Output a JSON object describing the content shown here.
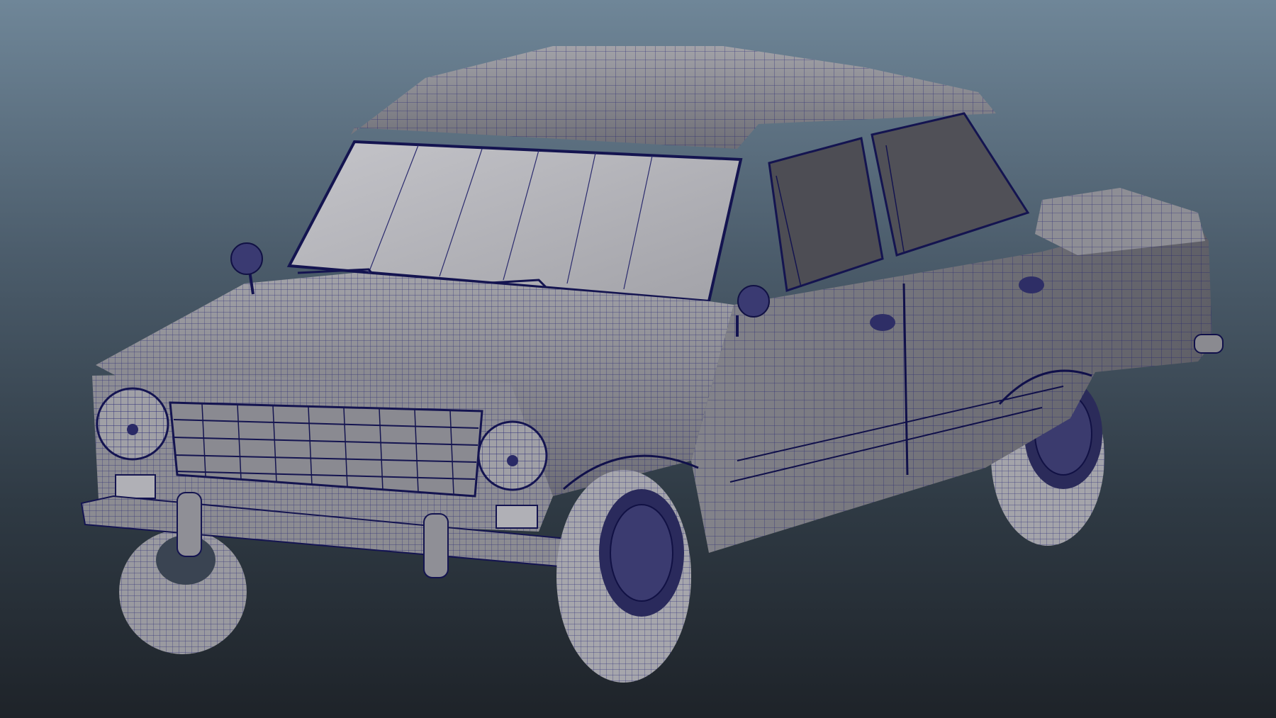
{
  "viewport": {
    "model": "classic-sedan-wireframe",
    "colors": {
      "background_top": "#6f8698",
      "background_bottom": "#1e2329",
      "body_shade": "#8b8b91",
      "body_shadow": "#5e5e66",
      "wire": "#1a1a6e",
      "glass": "#b3b3b8",
      "side_glass": "#4f4f55",
      "tire": "#a7a7ad"
    }
  }
}
